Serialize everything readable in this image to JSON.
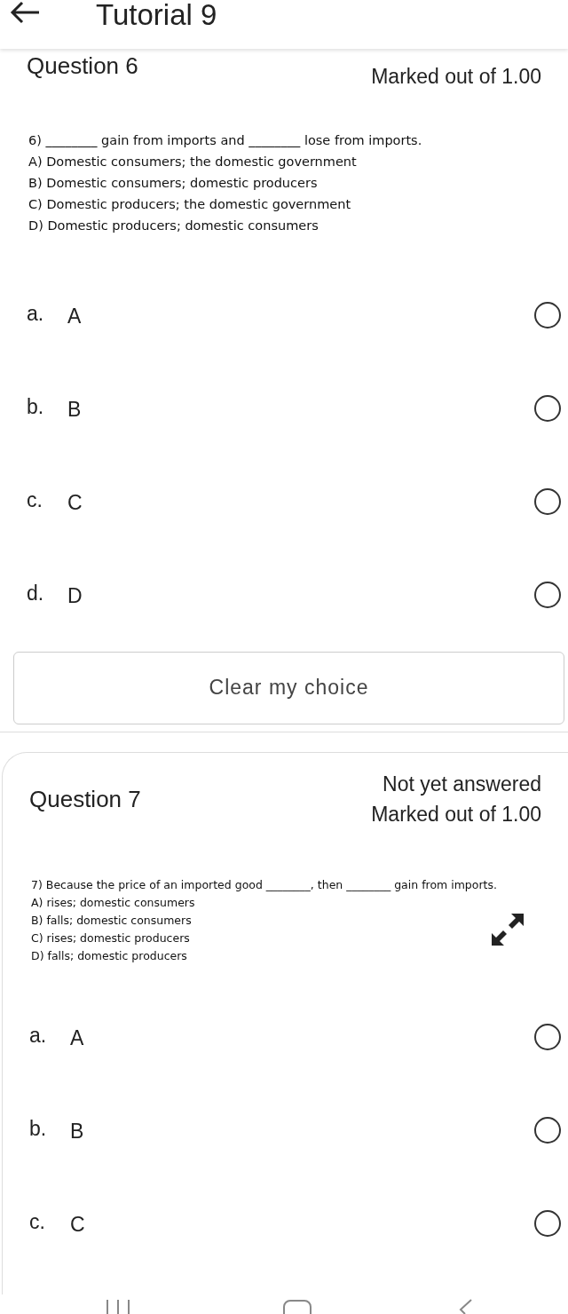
{
  "header": {
    "title": "Tutorial 9"
  },
  "questions": [
    {
      "title": "Question 6",
      "marks": "Marked out of 1.00",
      "stem": "6) ________ gain from imports and ________ lose from imports.",
      "choices_text": [
        "A) Domestic consumers; the domestic government",
        "B) Domestic consumers; domestic producers",
        "C) Domestic producers; the domestic government",
        "D) Domestic producers; domestic consumers"
      ],
      "options": [
        {
          "letter": "a.",
          "label": "A",
          "selected": false
        },
        {
          "letter": "b.",
          "label": "B",
          "selected": false
        },
        {
          "letter": "c.",
          "label": "C",
          "selected": false
        },
        {
          "letter": "d.",
          "label": "D",
          "selected": false
        }
      ],
      "clear_button": "Clear my choice"
    },
    {
      "title": "Question 7",
      "status": "Not yet answered",
      "marks": "Marked out of 1.00",
      "stem": "7) Because the price of an imported good ________, then ________ gain from imports.",
      "choices_text": [
        "A) rises; domestic consumers",
        "B) falls; domestic consumers",
        "C) rises; domestic producers",
        "D) falls; domestic producers"
      ],
      "expand_icon": true,
      "options": [
        {
          "letter": "a.",
          "label": "A",
          "selected": false
        },
        {
          "letter": "b.",
          "label": "B",
          "selected": false
        },
        {
          "letter": "c.",
          "label": "C",
          "selected": false
        }
      ]
    }
  ]
}
